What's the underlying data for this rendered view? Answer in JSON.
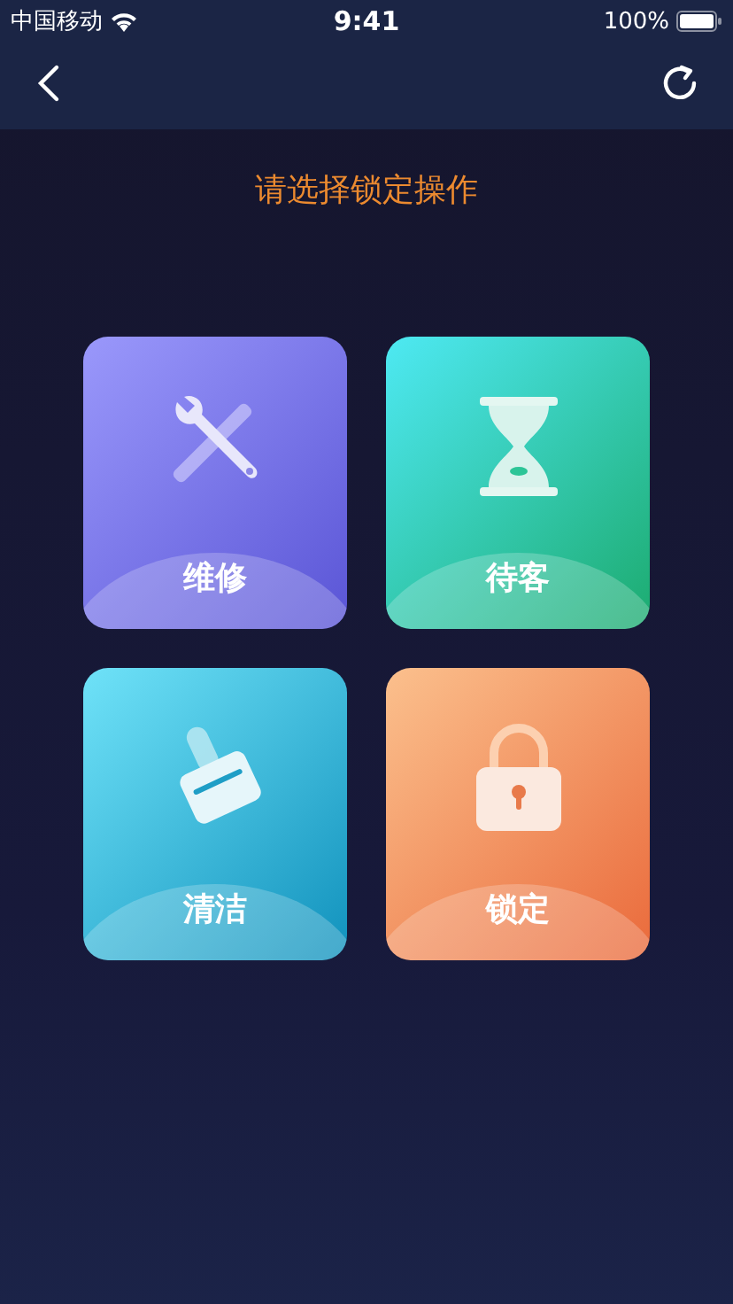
{
  "status_bar": {
    "carrier": "中国移动",
    "time": "9:41",
    "battery": "100%"
  },
  "title": "请选择锁定操作",
  "options": [
    {
      "kind": "repair",
      "label": "维修"
    },
    {
      "kind": "waiting",
      "label": "待客"
    },
    {
      "kind": "cleaning",
      "label": "清洁"
    },
    {
      "kind": "lock",
      "label": "锁定"
    }
  ]
}
